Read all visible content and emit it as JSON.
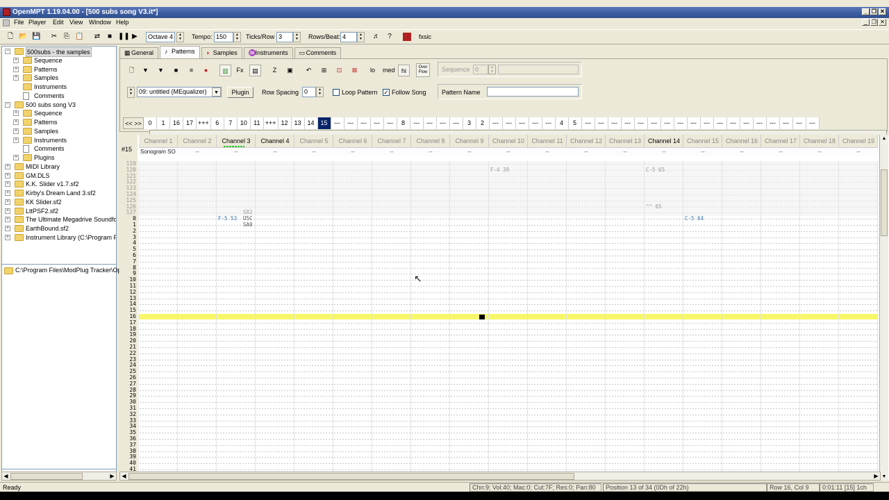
{
  "titlebar": {
    "title": "OpenMPT 1.19.04.00 - [500 subs song V3.it*]"
  },
  "menubar": {
    "items": [
      "File",
      "Player",
      "Edit",
      "View",
      "Window",
      "Help"
    ]
  },
  "toolbar": {
    "octave": "Octave 4",
    "tempo_label": "Tempo:",
    "tempo_value": "150",
    "ticks_label": "Ticks/Row",
    "ticks_value": "3",
    "rows_label": "Rows/Beat:",
    "rows_value": "4",
    "fxsic": "fxsic"
  },
  "tree": {
    "nodes": [
      {
        "label": "500subs - the samples",
        "level": 0,
        "type": "folder",
        "exp": "minus",
        "selected": true
      },
      {
        "label": "Sequence",
        "level": 1,
        "type": "folder",
        "exp": "plus"
      },
      {
        "label": "Patterns",
        "level": 1,
        "type": "folder",
        "exp": "plus"
      },
      {
        "label": "Samples",
        "level": 1,
        "type": "folder",
        "exp": "plus"
      },
      {
        "label": "Instruments",
        "level": 1,
        "type": "folder",
        "exp": "none"
      },
      {
        "label": "Comments",
        "level": 1,
        "type": "doc",
        "exp": "none"
      },
      {
        "label": "500 subs song V3",
        "level": 0,
        "type": "folder",
        "exp": "minus"
      },
      {
        "label": "Sequence",
        "level": 1,
        "type": "folder",
        "exp": "plus"
      },
      {
        "label": "Patterns",
        "level": 1,
        "type": "folder",
        "exp": "plus"
      },
      {
        "label": "Samples",
        "level": 1,
        "type": "folder",
        "exp": "plus"
      },
      {
        "label": "Instruments",
        "level": 1,
        "type": "folder",
        "exp": "plus"
      },
      {
        "label": "Comments",
        "level": 1,
        "type": "doc",
        "exp": "none"
      },
      {
        "label": "Plugins",
        "level": 1,
        "type": "folder",
        "exp": "plus"
      },
      {
        "label": "MIDI Library",
        "level": 0,
        "type": "folder",
        "exp": "plus"
      },
      {
        "label": "GM.DLS",
        "level": 0,
        "type": "folder",
        "exp": "plus"
      },
      {
        "label": "K.K. Slider v1.7.sf2",
        "level": 0,
        "type": "folder",
        "exp": "plus"
      },
      {
        "label": "Kirby's Dream Land 3.sf2",
        "level": 0,
        "type": "folder",
        "exp": "plus"
      },
      {
        "label": "KK Slider.sf2",
        "level": 0,
        "type": "folder",
        "exp": "plus"
      },
      {
        "label": "LttPSF2.sf2",
        "level": 0,
        "type": "folder",
        "exp": "plus"
      },
      {
        "label": "The Ultimate Megadrive Soundfont",
        "level": 0,
        "type": "folder",
        "exp": "plus"
      },
      {
        "label": "EarthBound.sf2",
        "level": 0,
        "type": "folder",
        "exp": "plus"
      },
      {
        "label": "Instrument Library (C:\\Program File",
        "level": 0,
        "type": "folder",
        "exp": "plus"
      }
    ],
    "path": "C:\\Program Files\\ModPlug Tracker\\Op"
  },
  "tabs": [
    {
      "label": "General",
      "active": false,
      "icon": "general-icon"
    },
    {
      "label": "Patterns",
      "active": true,
      "icon": "note-icon"
    },
    {
      "label": "Samples",
      "active": false,
      "icon": "wave-icon"
    },
    {
      "label": "Instruments",
      "active": false,
      "icon": "instrument-icon"
    },
    {
      "label": "Comments",
      "active": false,
      "icon": "comment-icon"
    }
  ],
  "patterns_panel": {
    "icon_row": [
      "lo",
      "med",
      "hi"
    ],
    "overflow_label": "Over\nFlow",
    "sequence_label": "Sequence",
    "sequence_value": "0",
    "pattern_select": "09: untitled (MEqualizer)",
    "plugin_button": "Plugin",
    "row_spacing_label": "Row Spacing",
    "row_spacing_value": "0",
    "loop_pattern_label": "Loop Pattern",
    "loop_pattern_checked": false,
    "follow_song_label": "Follow Song",
    "follow_song_checked": true,
    "pattern_name_label": "Pattern Name",
    "pattern_name_value": "",
    "order_nav": "<<  >>",
    "order_list": [
      "0",
      "1",
      "16",
      "17",
      "+++",
      "6",
      "7",
      "10",
      "11",
      "+++",
      "12",
      "13",
      "14",
      "15",
      "---",
      "---",
      "---",
      "---",
      "---",
      "8",
      "---",
      "---",
      "---",
      "---",
      "3",
      "2",
      "---",
      "---",
      "---",
      "---",
      "---",
      "4",
      "5",
      "---",
      "---",
      "---",
      "---",
      "---",
      "---",
      "---",
      "---",
      "---",
      "---",
      "---",
      "---",
      "---",
      "---",
      "---",
      "---",
      "---",
      "---"
    ],
    "order_current_index": 13
  },
  "pattern_editor": {
    "pattern_number": "#15",
    "channels": [
      {
        "name": "Channel 1",
        "active": false,
        "plugin": "Sonogram SO",
        "vu": false
      },
      {
        "name": "Channel 2",
        "active": false,
        "plugin": "--",
        "vu": false
      },
      {
        "name": "Channel 3",
        "active": true,
        "plugin": "--",
        "vu": true
      },
      {
        "name": "Channel 4",
        "active": true,
        "plugin": "--",
        "vu": false
      },
      {
        "name": "Channel 5",
        "active": false,
        "plugin": "--",
        "vu": false
      },
      {
        "name": "Channel 6",
        "active": false,
        "plugin": "--",
        "vu": false
      },
      {
        "name": "Channel 7",
        "active": false,
        "plugin": "--",
        "vu": false
      },
      {
        "name": "Channel 8",
        "active": false,
        "plugin": "--",
        "vu": false
      },
      {
        "name": "Channel 9",
        "active": false,
        "plugin": "--",
        "vu": false
      },
      {
        "name": "Channel 10",
        "active": false,
        "plugin": "--",
        "vu": false
      },
      {
        "name": "Channel 11",
        "active": false,
        "plugin": "--",
        "vu": false
      },
      {
        "name": "Channel 12",
        "active": false,
        "plugin": "--",
        "vu": false
      },
      {
        "name": "Channel 13",
        "active": false,
        "plugin": "--",
        "vu": false
      },
      {
        "name": "Channel 14",
        "active": true,
        "plugin": "--",
        "vu": false
      },
      {
        "name": "Channel 15",
        "active": false,
        "plugin": "--",
        "vu": false
      },
      {
        "name": "Channel 16",
        "active": false,
        "plugin": "--",
        "vu": false
      },
      {
        "name": "Channel 17",
        "active": false,
        "plugin": "--",
        "vu": false
      },
      {
        "name": "Channel 18",
        "active": false,
        "plugin": "--",
        "vu": false
      },
      {
        "name": "Channel 19",
        "active": false,
        "plugin": "--",
        "vu": false
      }
    ],
    "prev_rows": [
      "119",
      "120",
      "121",
      "122",
      "123",
      "124",
      "125",
      "126",
      "127"
    ],
    "rows": [
      "0",
      "1",
      "2",
      "3",
      "4",
      "5",
      "6",
      "7",
      "8",
      "9",
      "10",
      "11",
      "12",
      "13",
      "14",
      "15",
      "16",
      "17",
      "18",
      "19",
      "20",
      "21",
      "22",
      "23",
      "24",
      "25",
      "26",
      "27",
      "28",
      "29",
      "30",
      "31",
      "32",
      "33",
      "34",
      "35",
      "36",
      "37",
      "38",
      "39",
      "40",
      "41"
    ],
    "current_row": "16",
    "notes": [
      {
        "text": "F-4 39",
        "channel": 10,
        "row": "120",
        "prev": true
      },
      {
        "text": "C-5 65",
        "channel": 14,
        "row": "120",
        "prev": true
      },
      {
        "text": "^^ 65",
        "channel": 14,
        "row": "126",
        "prev": true
      },
      {
        "text": "S82",
        "channel": 3,
        "row": "127",
        "prev": true,
        "fx": true
      },
      {
        "text": "F-5 53",
        "channel": 3,
        "row": "0",
        "prev": false
      },
      {
        "text": "U5C",
        "channel": 3,
        "row": "0",
        "prev": false,
        "fx": true
      },
      {
        "text": "SA0",
        "channel": 3,
        "row": "1",
        "prev": false,
        "fx": true
      },
      {
        "text": "C-5 64",
        "channel": 15,
        "row": "0",
        "prev": false
      }
    ]
  },
  "statusbar": {
    "ready": "Ready",
    "channel_info": "Chn:9; Vol:40; Mac:0; Cut:7F; Res:0; Pan:80",
    "position": "Position 13 of 34 (0Dh of 22h)",
    "rowcol": "Row 16, Col 9",
    "time": "0:01:11  [15] 1ch"
  },
  "colors": {
    "accent": "#0a246a",
    "highlight_row": "#f7f76a",
    "note_blue": "#3a7ab8",
    "vu_green": "#2cc12c"
  }
}
